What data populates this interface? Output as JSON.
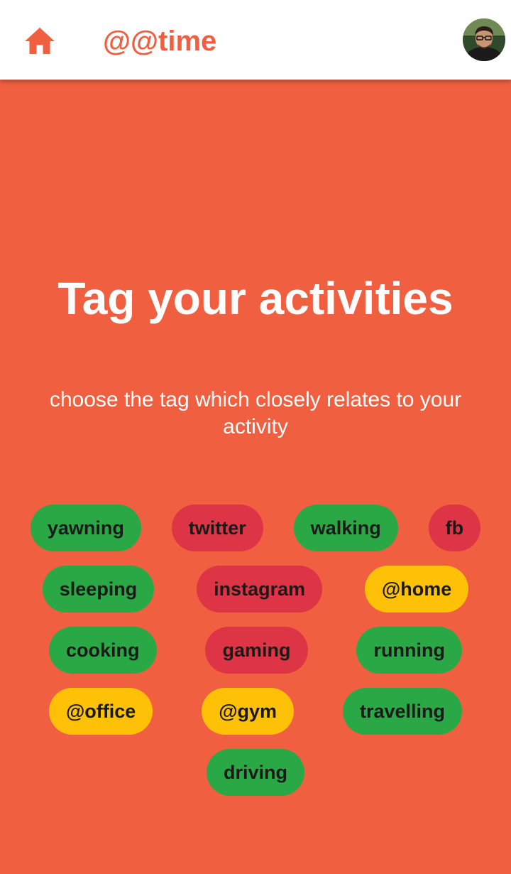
{
  "app_bar": {
    "home_icon": "home-icon",
    "title": "@@time",
    "avatar_icon": "user-avatar"
  },
  "colors": {
    "primary": "#f06040",
    "app_bar_bg": "#ffffff",
    "chip_activity": "#2aa845",
    "chip_social": "#dd3545",
    "chip_location": "#ffc107",
    "chip_text": "#1a1a1a"
  },
  "main": {
    "headline": "Tag your activities",
    "subtitle": "choose the tag which closely relates to your activity"
  },
  "tag_rows": [
    [
      {
        "label": "yawning",
        "category": "activity"
      },
      {
        "label": "twitter",
        "category": "social"
      },
      {
        "label": "walking",
        "category": "activity"
      },
      {
        "label": "fb",
        "category": "social"
      }
    ],
    [
      {
        "label": "sleeping",
        "category": "activity"
      },
      {
        "label": "instagram",
        "category": "social"
      },
      {
        "label": "@home",
        "category": "location"
      }
    ],
    [
      {
        "label": "cooking",
        "category": "activity"
      },
      {
        "label": "gaming",
        "category": "social"
      },
      {
        "label": "running",
        "category": "activity"
      }
    ],
    [
      {
        "label": "@office",
        "category": "location"
      },
      {
        "label": "@gym",
        "category": "location"
      },
      {
        "label": "travelling",
        "category": "activity"
      }
    ],
    [
      {
        "label": "driving",
        "category": "activity"
      }
    ]
  ]
}
